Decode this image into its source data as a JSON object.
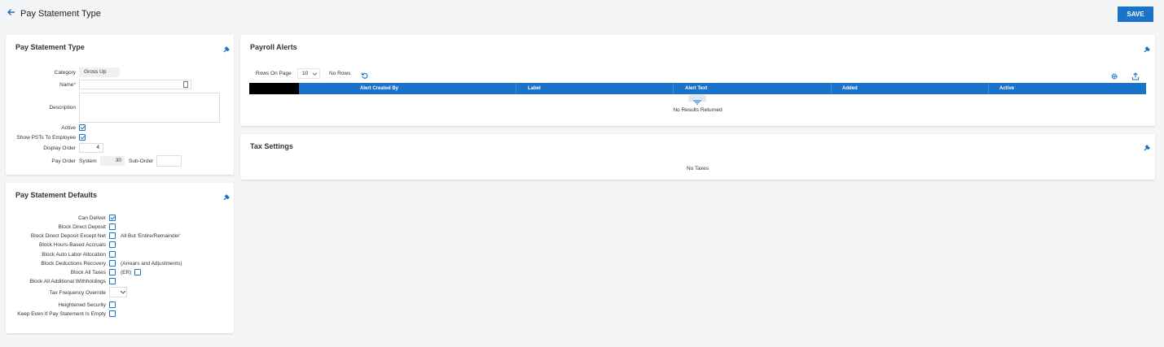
{
  "header": {
    "title": "Pay Statement Type",
    "save_label": "SAVE",
    "back_icon": "arrow-left-icon"
  },
  "type_panel": {
    "title": "Pay Statement Type",
    "category_label": "Category",
    "category_value": "Gross Up",
    "name_label": "Name",
    "name_required": "*",
    "name_value": "",
    "description_label": "Description",
    "description_value": "",
    "active_label": "Active",
    "active_checked": true,
    "show_psts_label": "Show PSTs To Employee",
    "show_psts_checked": true,
    "display_order_label": "Display Order",
    "display_order_value": "4",
    "pay_order_label": "Pay Order",
    "system_label": "System",
    "system_value": "30",
    "sub_order_label": "Sub-Order",
    "sub_order_value": ""
  },
  "defaults_panel": {
    "title": "Pay Statement Defaults",
    "items": [
      {
        "label": "Can Deliver",
        "checked": true,
        "note": ""
      },
      {
        "label": "Block Direct Deposit",
        "checked": false,
        "note": ""
      },
      {
        "label": "Block Direct Deposit Except Net",
        "checked": false,
        "note": "All But 'Entire/Remainder'"
      },
      {
        "label": "Block Hours-Based Accruals",
        "checked": false,
        "note": ""
      },
      {
        "label": "Block Auto Labor Allocation",
        "checked": false,
        "note": ""
      },
      {
        "label": "Block Deductions Recovery",
        "checked": false,
        "note": "(Arrears and Adjustments)"
      },
      {
        "label": "Block All Taxes",
        "checked": false,
        "note": "(ER)"
      },
      {
        "label": "Block All Additional Withholdings",
        "checked": false,
        "note": ""
      },
      {
        "label": "Tax Frequency Override",
        "checked": false,
        "note": ""
      },
      {
        "label": "Heightened Security",
        "checked": false,
        "note": ""
      },
      {
        "label": "Keep Even If Pay Statement Is Empty",
        "checked": false,
        "note": ""
      }
    ],
    "tax_frequency_value": ""
  },
  "alerts_panel": {
    "title": "Payroll Alerts",
    "rows_on_page_label": "Rows On Page",
    "rows_on_page_value": "10",
    "no_rows_label": "No Rows",
    "columns": [
      "",
      "Alert Created By",
      "Label",
      "Alert Text",
      "Added",
      "Active"
    ],
    "empty_text": "No Results Returned"
  },
  "tax_panel": {
    "title": "Tax Settings",
    "empty_text": "No Taxes"
  },
  "colors": {
    "accent": "#1a73c9",
    "background": "#f4f5f7"
  }
}
